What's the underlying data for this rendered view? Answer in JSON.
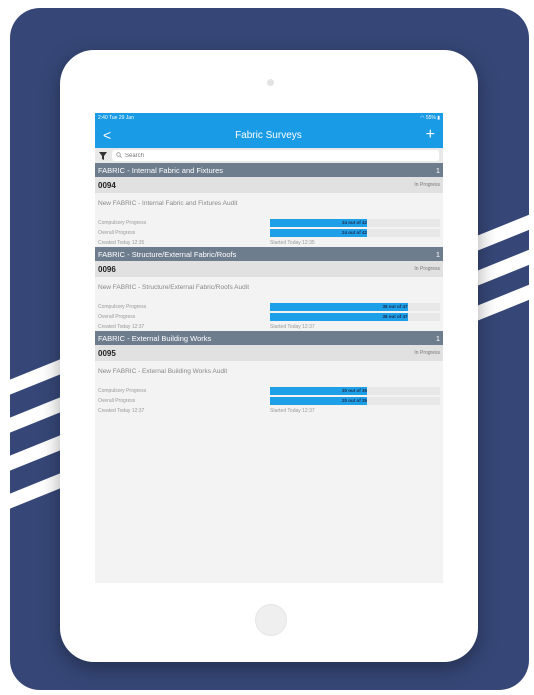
{
  "status_bar": {
    "time": "2:40  Tue 29 Jan",
    "battery": "55%"
  },
  "nav": {
    "back": "<",
    "title": "Fabric Surveys",
    "add": "+"
  },
  "search": {
    "placeholder": "Search"
  },
  "sections": [
    {
      "title": "FABRIC  - Internal Fabric and Fixtures",
      "count": "1",
      "survey": {
        "id": "0094",
        "status": "In Progress",
        "title": "New FABRIC  - Internal Fabric and Fixtures Audit",
        "compulsory_label": "Compulsory Progress",
        "compulsory_text": "24 out of 42",
        "compulsory_fraction": 0.571,
        "overall_label": "Overall Progress",
        "overall_text": "24 out of 42",
        "overall_fraction": 0.571,
        "created": "Created Today 12:35",
        "started": "Started Today 12:35"
      }
    },
    {
      "title": "FABRIC  - Structure/External Fabric/Roofs",
      "count": "1",
      "survey": {
        "id": "0096",
        "status": "In Progress",
        "title": "New FABRIC  - Structure/External Fabric/Roofs Audit",
        "compulsory_label": "Compulsory Progress",
        "compulsory_text": "38 out of 47",
        "compulsory_fraction": 0.809,
        "overall_label": "Overall Progress",
        "overall_text": "38 out of 47",
        "overall_fraction": 0.809,
        "created": "Created Today 12:37",
        "started": "Started Today 12:37"
      }
    },
    {
      "title": "FABRIC - External Building Works",
      "count": "1",
      "survey": {
        "id": "0095",
        "status": "In Progress",
        "title": "New FABRIC - External Building Works Audit",
        "compulsory_label": "Compulsory Progress",
        "compulsory_text": "20 out of 35",
        "compulsory_fraction": 0.571,
        "overall_label": "Overall Progress",
        "overall_text": "20 out of 35",
        "overall_fraction": 0.571,
        "created": "Created Today 12:37",
        "started": "Started Today 12:37"
      }
    }
  ],
  "colors": {
    "background_panel": "#364777",
    "nav_blue": "#1a9be5",
    "section_header": "#6e7d8e",
    "progress_fill": "#1ea0e8"
  }
}
